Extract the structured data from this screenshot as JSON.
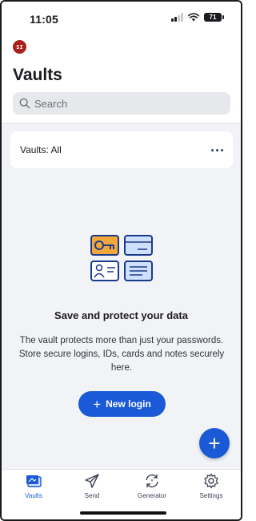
{
  "status_bar": {
    "time": "11:05",
    "battery": "71"
  },
  "header": {
    "avatar_initials": "SI",
    "title": "Vaults",
    "search_placeholder": "Search"
  },
  "vault_filter": {
    "label": "Vaults: All",
    "menu_icon": "more-horizontal-icon"
  },
  "empty_state": {
    "title": "Save and protect your data",
    "body": "The vault protects more than just your passwords. Store secure logins, IDs, cards and notes securely here.",
    "button_label": "New login"
  },
  "fab": {
    "icon": "plus-icon"
  },
  "tabs": [
    {
      "label": "Vaults",
      "icon": "vault-icon",
      "active": true
    },
    {
      "label": "Send",
      "icon": "send-icon",
      "active": false
    },
    {
      "label": "Generator",
      "icon": "generator-icon",
      "active": false
    },
    {
      "label": "Settings",
      "icon": "gear-icon",
      "active": false
    }
  ],
  "colors": {
    "accent": "#1a5ad6",
    "avatar": "#a8221c",
    "background": "#f2f3f6",
    "illustration_fill": "#f3a73b",
    "illustration_stroke": "#1a3b8a"
  }
}
